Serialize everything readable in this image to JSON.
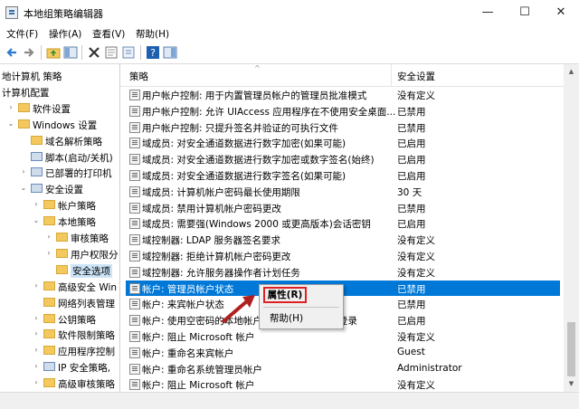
{
  "window": {
    "title": "本地组策略编辑器",
    "controls": {
      "minimize": "—",
      "maximize": "☐",
      "close": "✕"
    }
  },
  "menu": [
    "文件(F)",
    "操作(A)",
    "查看(V)",
    "帮助(H)"
  ],
  "toolbar": {
    "icons": [
      "back-arrow-icon",
      "forward-arrow-icon",
      "up-folder-icon",
      "show-tree-icon",
      "delete-icon",
      "properties-icon",
      "export-icon",
      "help-icon",
      "console-icon"
    ]
  },
  "tree": [
    {
      "label": "地计算机 策略",
      "level": 0,
      "expander": "",
      "folder": false
    },
    {
      "label": "计算机配置",
      "level": 0,
      "expander": "",
      "folder": false
    },
    {
      "label": "软件设置",
      "level": 1,
      "expander": "›",
      "folder": true
    },
    {
      "label": "Windows 设置",
      "level": 1,
      "expander": "⌄",
      "folder": true
    },
    {
      "label": "域名解析策略",
      "level": 2,
      "expander": "",
      "folder": true
    },
    {
      "label": "脚本(启动/关机)",
      "level": 2,
      "expander": "",
      "folder": false
    },
    {
      "label": "已部署的打印机",
      "level": 2,
      "expander": "›",
      "folder": false
    },
    {
      "label": "安全设置",
      "level": 2,
      "expander": "⌄",
      "folder": false
    },
    {
      "label": "帐户策略",
      "level": 3,
      "expander": "›",
      "folder": true
    },
    {
      "label": "本地策略",
      "level": 3,
      "expander": "⌄",
      "folder": true
    },
    {
      "label": "审核策略",
      "level": 4,
      "expander": "›",
      "folder": true
    },
    {
      "label": "用户权限分",
      "level": 4,
      "expander": "›",
      "folder": true
    },
    {
      "label": "安全选项",
      "level": 4,
      "expander": "",
      "folder": true,
      "selected": true
    },
    {
      "label": "高级安全 Win",
      "level": 3,
      "expander": "›",
      "folder": true
    },
    {
      "label": "网络列表管理",
      "level": 3,
      "expander": "",
      "folder": true
    },
    {
      "label": "公钥策略",
      "level": 3,
      "expander": "›",
      "folder": true
    },
    {
      "label": "软件限制策略",
      "level": 3,
      "expander": "›",
      "folder": true
    },
    {
      "label": "应用程序控制",
      "level": 3,
      "expander": "›",
      "folder": true
    },
    {
      "label": "IP 安全策略,",
      "level": 3,
      "expander": "›",
      "folder": false
    },
    {
      "label": "高级审核策略",
      "level": 3,
      "expander": "›",
      "folder": true
    }
  ],
  "table": {
    "headers": [
      "策略",
      "安全设置"
    ],
    "rows": [
      {
        "policy": "用户帐户控制: 用于内置管理员帐户的管理员批准模式",
        "setting": "没有定义"
      },
      {
        "policy": "用户帐户控制: 允许 UIAccess 应用程序在不使用安全桌面...",
        "setting": "已禁用"
      },
      {
        "policy": "用户帐户控制: 只提升签名并验证的可执行文件",
        "setting": "已禁用"
      },
      {
        "policy": "域成员: 对安全通道数据进行数字加密(如果可能)",
        "setting": "已启用"
      },
      {
        "policy": "域成员: 对安全通道数据进行数字加密或数字签名(始终)",
        "setting": "已启用"
      },
      {
        "policy": "域成员: 对安全通道数据进行数字签名(如果可能)",
        "setting": "已启用"
      },
      {
        "policy": "域成员: 计算机帐户密码最长使用期限",
        "setting": "30 天"
      },
      {
        "policy": "域成员: 禁用计算机帐户密码更改",
        "setting": "已禁用"
      },
      {
        "policy": "域成员: 需要强(Windows 2000 或更高版本)会话密钥",
        "setting": "已启用"
      },
      {
        "policy": "域控制器: LDAP 服务器签名要求",
        "setting": "没有定义"
      },
      {
        "policy": "域控制器: 拒绝计算机帐户密码更改",
        "setting": "没有定义"
      },
      {
        "policy": "域控制器: 允许服务器操作者计划任务",
        "setting": "没有定义"
      },
      {
        "policy": "帐户: 管理员帐户状态",
        "setting": "已禁用",
        "selected": true
      },
      {
        "policy": "帐户: 来宾帐户状态",
        "setting": "已禁用"
      },
      {
        "policy": "帐户: 使用空密码的本地帐户只允许进行控制台登录",
        "setting": "已启用"
      },
      {
        "policy": "帐户: 阻止 Microsoft 帐户",
        "setting": "没有定义"
      },
      {
        "policy": "帐户: 重命名来宾帐户",
        "setting": "Guest"
      },
      {
        "policy": "帐户: 重命名系统管理员帐户",
        "setting": "Administrator"
      },
      {
        "policy": "帐户: 阻止 Microsoft 帐户",
        "setting": "没有定义"
      }
    ]
  },
  "context_menu": {
    "properties": "属性(R)",
    "help": "帮助(H)"
  },
  "colors": {
    "selection": "#0078d7",
    "highlight_border": "#e02020",
    "arrow": "#b02020"
  }
}
